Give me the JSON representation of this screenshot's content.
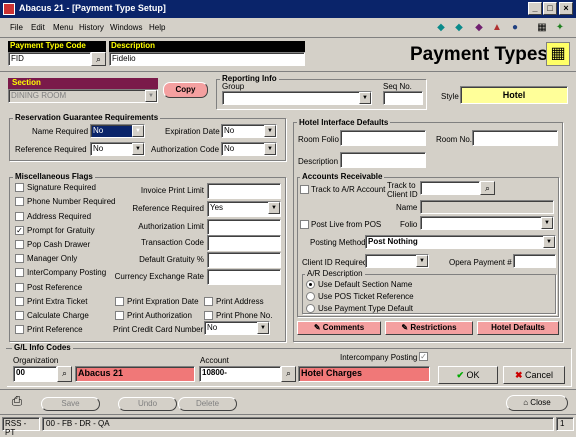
{
  "window": {
    "title": "Abacus 21 - [Payment Type Setup]"
  },
  "menu": [
    "File",
    "Edit",
    "Menu",
    "History",
    "Windows",
    "Help"
  ],
  "header": {
    "payment_type_code_label": "Payment Type Code",
    "payment_type_code": "FID",
    "description_label": "Description",
    "description": "Fidelio",
    "page_title": "Payment Types"
  },
  "section": {
    "label": "Section",
    "value": "DINING ROOM",
    "copy": "Copy"
  },
  "reporting": {
    "title": "Reporting Info",
    "group_label": "Group",
    "seq_label": "Seq No.",
    "style_label": "Style",
    "style_value": "Hotel"
  },
  "reservation": {
    "title": "Reservation Guarantee Requirements",
    "name_required": "Name Required",
    "name_value": "No",
    "expiration_date": "Expiration Date",
    "expiration_value": "No",
    "reference_required": "Reference Required",
    "reference_value": "No",
    "authorization_code": "Authorization Code",
    "authorization_value": "No"
  },
  "misc": {
    "title": "Miscellaneous Flags",
    "checks": [
      {
        "label": "Signature Required",
        "checked": false
      },
      {
        "label": "Phone Number Required",
        "checked": false
      },
      {
        "label": "Address Required",
        "checked": false
      },
      {
        "label": "Prompt for Gratuity",
        "checked": true
      },
      {
        "label": "Pop Cash Drawer",
        "checked": false
      },
      {
        "label": "Manager Only",
        "checked": false
      },
      {
        "label": "InterCompany Posting",
        "checked": false
      },
      {
        "label": "Post Reference",
        "checked": false
      },
      {
        "label": "Print Extra Ticket",
        "checked": false
      },
      {
        "label": "Calculate Charge",
        "checked": false
      },
      {
        "label": "Print Reference",
        "checked": false
      }
    ],
    "fields": [
      {
        "label": "Invoice Print Limit",
        "value": ""
      },
      {
        "label": "Reference Required",
        "value": "Yes"
      },
      {
        "label": "Authorization Limit",
        "value": ""
      },
      {
        "label": "Transaction Code",
        "value": ""
      },
      {
        "label": "Default Gratuity %",
        "value": ""
      },
      {
        "label": "Currency Exchange Rate",
        "value": ""
      }
    ],
    "print_expiration": "Print Expration Date",
    "print_address": "Print Address",
    "print_authorization": "Print Authorization",
    "print_phone": "Print Phone No.",
    "print_cc_label": "Print Credit Card Number",
    "print_cc_value": "No"
  },
  "hotel": {
    "title": "Hotel Interface Defaults",
    "room_folio": "Room Folio",
    "room_no": "Room No.",
    "description": "Description",
    "ar_title": "Accounts Receivable",
    "track_ar": "Track to A/R Account",
    "track_client": "Track to Client ID",
    "name": "Name",
    "post_live": "Post Live from POS",
    "folio": "Folio",
    "posting_method_label": "Posting Method",
    "posting_method_value": "Post Nothing",
    "client_id_required": "Client ID Required",
    "opera_payment": "Opera Payment #",
    "ar_desc_title": "A/R Description",
    "radios": [
      {
        "label": "Use Default Section Name",
        "on": true
      },
      {
        "label": "Use POS Ticket Reference",
        "on": false
      },
      {
        "label": "Use Payment Type Default",
        "on": false
      }
    ],
    "comments": "Comments",
    "restrictions": "Restrictions",
    "hotel_defaults": "Hotel Defaults"
  },
  "gl": {
    "title": "G/L Info Codes",
    "organization_label": "Organization",
    "organization_code": "00",
    "organization_name": "Abacus 21",
    "account_label": "Account",
    "account_code": "10800-",
    "account_name": "Hotel Charges",
    "intercompany": "Intercompany Posting",
    "ok": "OK",
    "cancel": "Cancel"
  },
  "bottom": {
    "save": "Save",
    "undo": "Undo",
    "delete": "Delete",
    "close": "Close"
  },
  "status": {
    "left": "RSS - PT",
    "mid": "00 - FB - DR - QA",
    "right": "1"
  }
}
